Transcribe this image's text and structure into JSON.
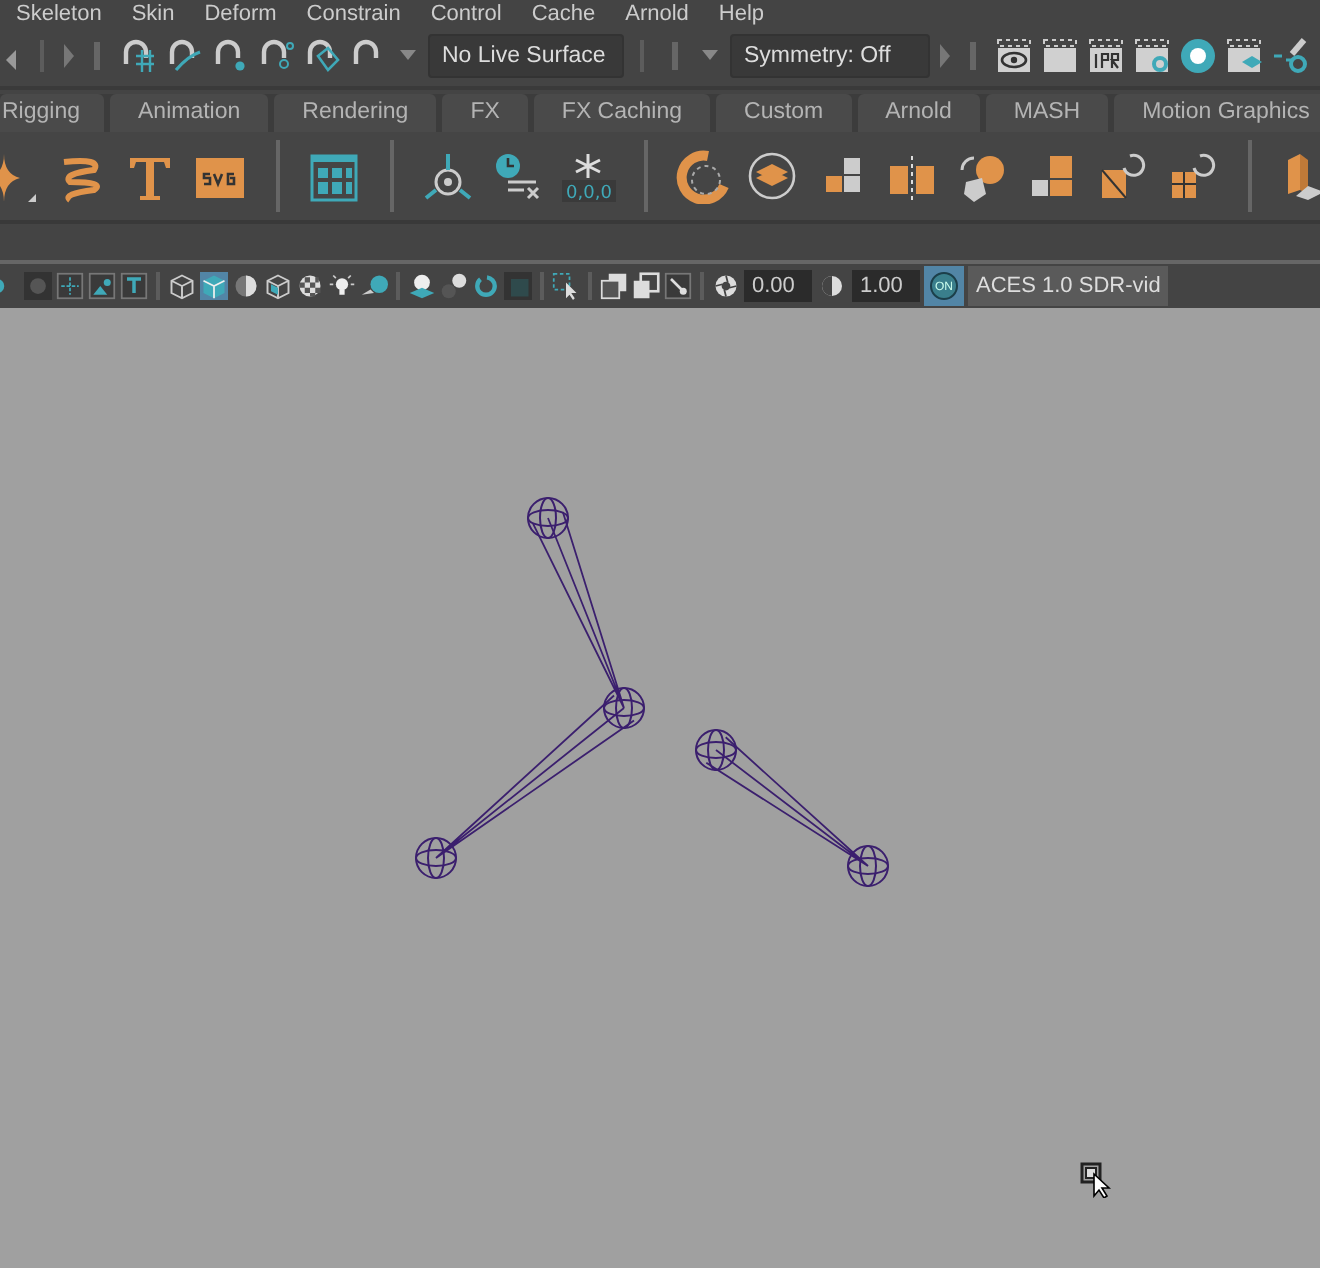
{
  "menu": [
    "Skeleton",
    "Skin",
    "Deform",
    "Constrain",
    "Control",
    "Cache",
    "Arnold",
    "Help"
  ],
  "status_line": {
    "live_surface": "No Live Surface",
    "symmetry": "Symmetry: Off"
  },
  "shelf": {
    "freeze_transform_label": "0,0,0"
  },
  "shelf_tabs": [
    "Rigging",
    "Animation",
    "Rendering",
    "FX",
    "FX Caching",
    "Custom",
    "Arnold",
    "MASH",
    "Motion Graphics"
  ],
  "panel_toolbar": {
    "smooth_shade": {
      "on": true
    },
    "exposure": "0.00",
    "gamma": "1.00",
    "color_management": {
      "on": true,
      "label": "ON"
    },
    "view_transform": "ACES 1.0 SDR-vid"
  }
}
